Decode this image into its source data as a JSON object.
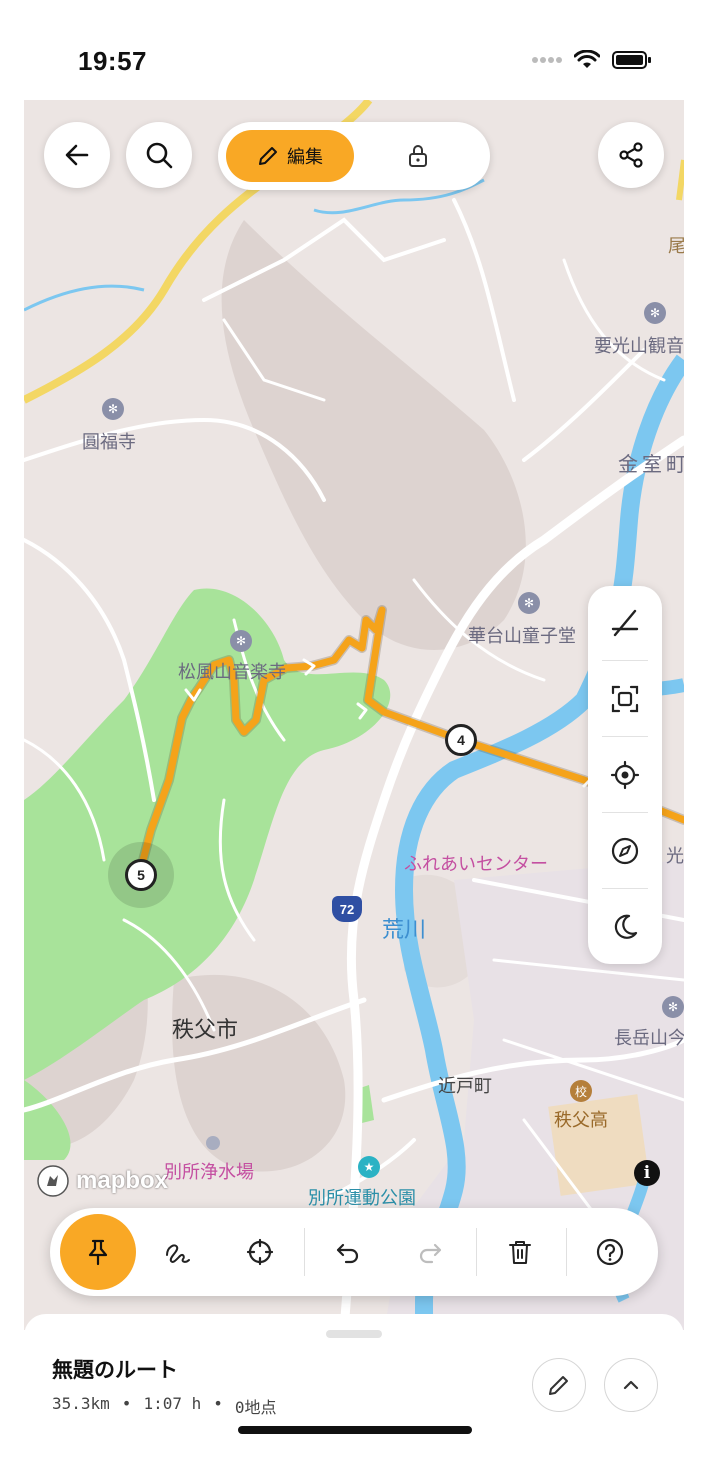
{
  "status_bar": {
    "time": "19:57"
  },
  "top_controls": {
    "back_icon": "arrow-left-icon",
    "search_icon": "search-icon",
    "edit_mode_label": "編集",
    "share_icon": "share-icon"
  },
  "map_labels": {
    "enpukuji": "圓福寺",
    "yokozan": "要光山観音",
    "kanamuro": "金室町",
    "ogura": "尾",
    "shoufuzan": "松風山音楽寺",
    "kadaizan": "華台山童子堂",
    "fureai": "ふれあいセンター",
    "arakawa": "荒川",
    "chichibu_city": "秩父市",
    "chougakusan": "長岳山今",
    "chikado": "近戸町",
    "chichibu_high": "秩父高",
    "bessho_jousui": "別所浄水場",
    "bessho_park": "別所運動公園",
    "hikari": "光",
    "road_number": "72"
  },
  "waypoints": {
    "a": "4",
    "b": "5"
  },
  "attribution": {
    "logo_text": "mapbox",
    "info_label": "i"
  },
  "right_tools": [
    {
      "name": "route-line-off-icon"
    },
    {
      "name": "fit-bounds-icon"
    },
    {
      "name": "locate-icon"
    },
    {
      "name": "compass-icon"
    },
    {
      "name": "dark-mode-icon"
    }
  ],
  "toolbar": [
    {
      "name": "pin-icon"
    },
    {
      "name": "freehand-icon"
    },
    {
      "name": "crosshair-icon"
    },
    {
      "name": "undo-icon"
    },
    {
      "name": "redo-icon"
    },
    {
      "name": "trash-icon"
    },
    {
      "name": "help-icon"
    }
  ],
  "sheet": {
    "title": "無題のルート",
    "distance": "35.3km",
    "sep1": "•",
    "duration": "1:07 h",
    "sep2": "•",
    "points": "0地点"
  },
  "colors": {
    "accent": "#f9a825",
    "route": "#f5a31a",
    "park": "#a8e39a",
    "river": "#7cc7f0",
    "highway": "#f3d764"
  }
}
